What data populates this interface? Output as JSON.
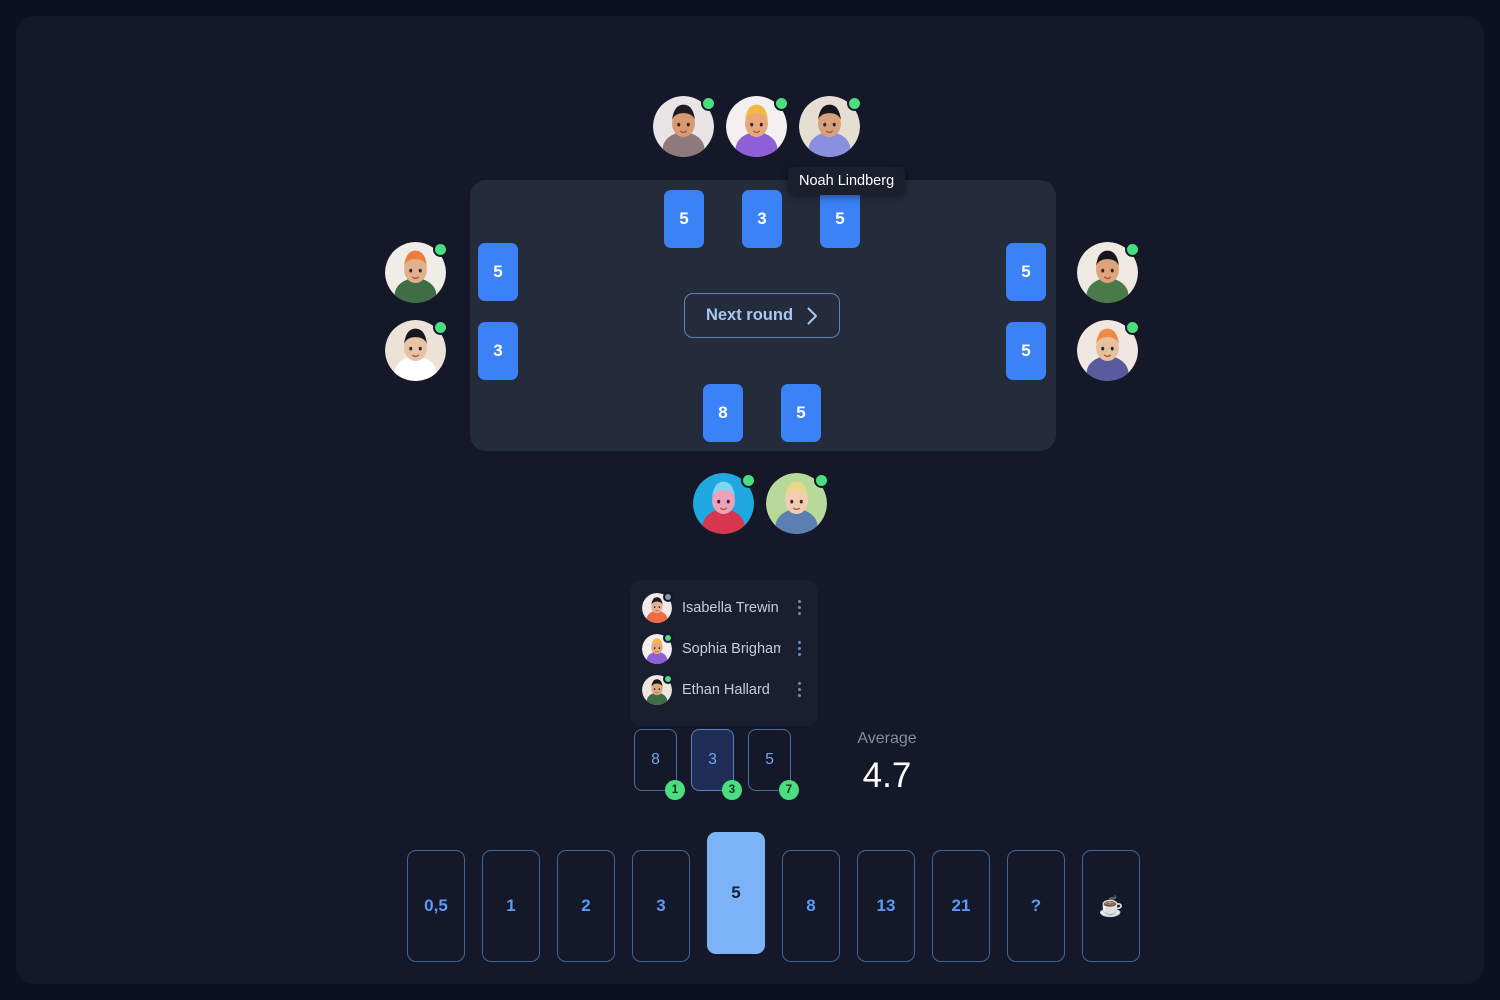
{
  "theme": {
    "page_bg": "#141828",
    "table_bg": "#242c3c",
    "card_blue": "#3b82f6",
    "accent_selected": "#7cb3f7",
    "online": "#4ade80",
    "offline": "#8b93a6"
  },
  "tooltip": {
    "text": "Noah Lindberg"
  },
  "seats": {
    "top": [
      {
        "name": "seat-top-1",
        "status": "online"
      },
      {
        "name": "seat-top-2",
        "status": "online"
      },
      {
        "name": "seat-top-3",
        "status": "online"
      }
    ],
    "bottom": [
      {
        "name": "seat-bottom-1",
        "status": "online"
      },
      {
        "name": "seat-bottom-2",
        "status": "online"
      }
    ],
    "left": [
      {
        "name": "seat-left-1",
        "status": "online"
      },
      {
        "name": "seat-left-2",
        "status": "online"
      }
    ],
    "right": [
      {
        "name": "seat-right-1",
        "status": "online"
      },
      {
        "name": "seat-right-2",
        "status": "online"
      }
    ]
  },
  "table": {
    "revealed_cards": {
      "top": [
        "5",
        "3",
        "5"
      ],
      "left": [
        "5",
        "3"
      ],
      "right": [
        "5",
        "5"
      ],
      "bottom": [
        "8",
        "5"
      ]
    },
    "next_round_label": "Next round",
    "next_round_icon": "chevron-right-icon"
  },
  "players_panel": {
    "players": [
      {
        "name": "Isabella Trewin",
        "status": "offline",
        "menu_icon": "more-vertical-icon"
      },
      {
        "name": "Sophia Brigham",
        "status": "online",
        "menu_icon": "more-vertical-icon"
      },
      {
        "name": "Ethan Hallard",
        "status": "online",
        "menu_icon": "more-vertical-icon"
      }
    ]
  },
  "results": {
    "cards": [
      {
        "value": "8",
        "count": "1",
        "highlight": false
      },
      {
        "value": "3",
        "count": "3",
        "highlight": true
      },
      {
        "value": "5",
        "count": "7",
        "highlight": false
      }
    ],
    "average_label": "Average",
    "average_value": "4.7"
  },
  "deck": {
    "cards": [
      {
        "value": "0,5",
        "selected": false,
        "icon": null
      },
      {
        "value": "1",
        "selected": false,
        "icon": null
      },
      {
        "value": "2",
        "selected": false,
        "icon": null
      },
      {
        "value": "3",
        "selected": false,
        "icon": null
      },
      {
        "value": "5",
        "selected": true,
        "icon": null
      },
      {
        "value": "8",
        "selected": false,
        "icon": null
      },
      {
        "value": "13",
        "selected": false,
        "icon": null
      },
      {
        "value": "21",
        "selected": false,
        "icon": null
      },
      {
        "value": "?",
        "selected": false,
        "icon": null
      },
      {
        "value": "☕",
        "selected": false,
        "icon": "coffee-icon"
      }
    ]
  }
}
